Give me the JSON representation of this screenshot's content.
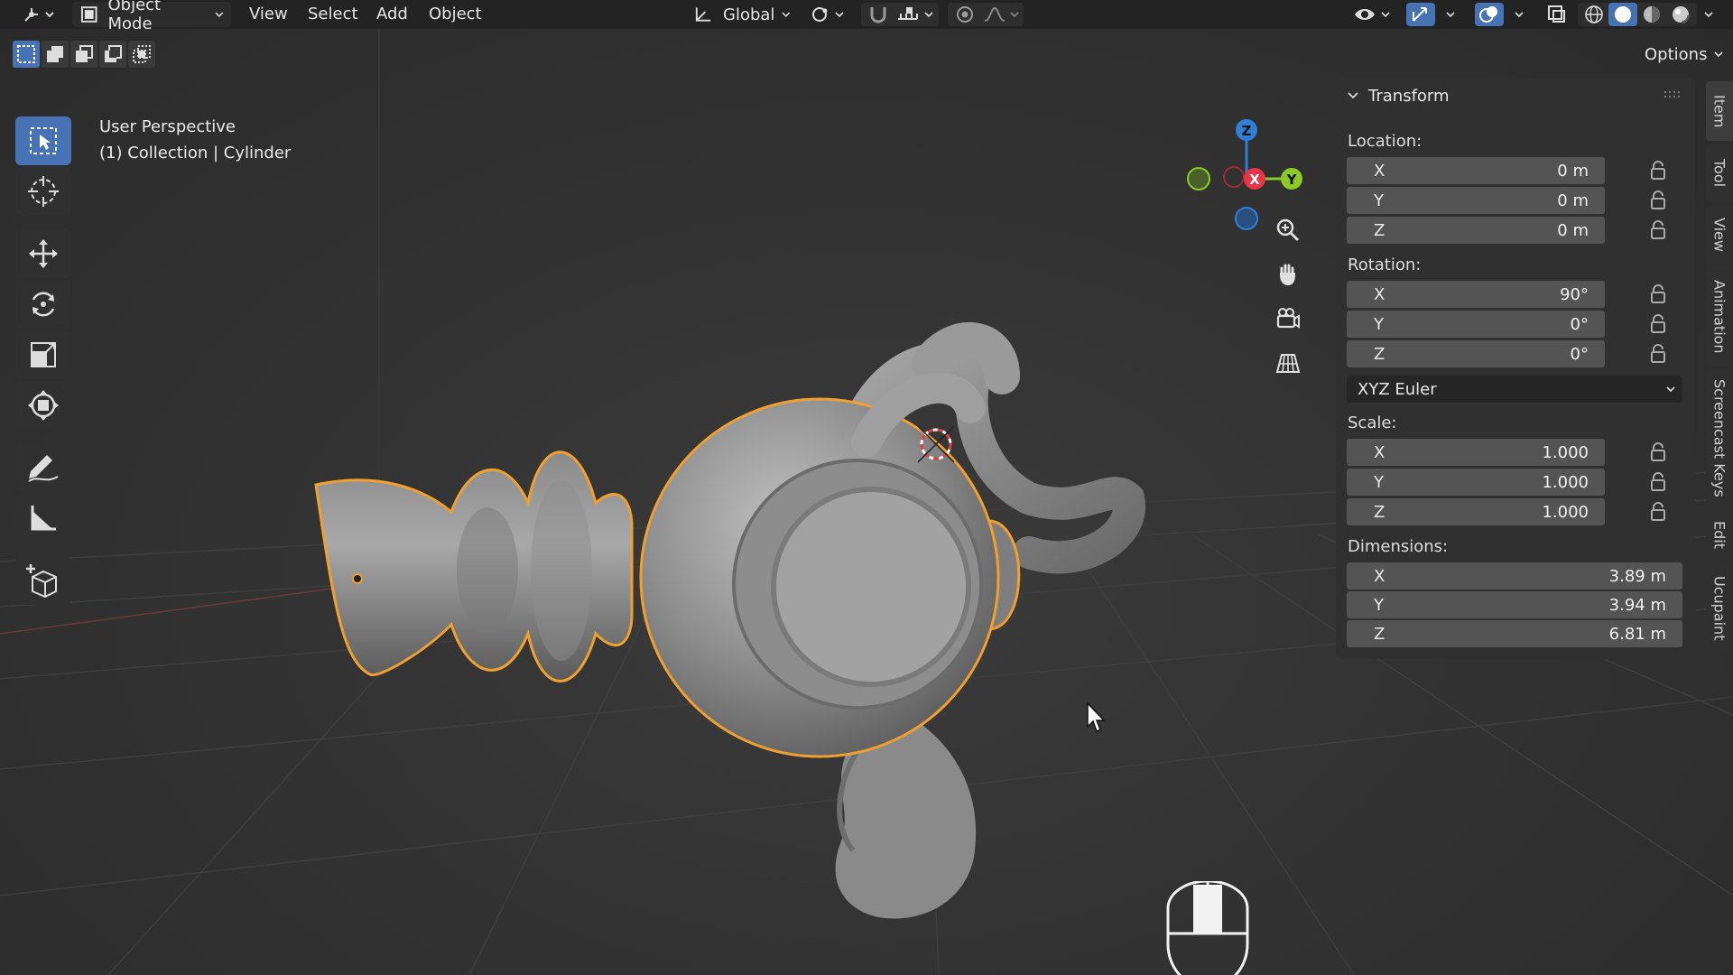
{
  "header": {
    "mode_label": "Object Mode",
    "menus": [
      "View",
      "Select",
      "Add",
      "Object"
    ],
    "orientation_label": "Global",
    "options_label": "Options"
  },
  "viewport": {
    "perspective_label": "User Perspective",
    "collection_label": "(1) Collection | Cylinder",
    "gizmo": {
      "x_label": "X",
      "y_label": "Y",
      "z_label": "Z"
    }
  },
  "toolbar": {
    "tools": [
      "select-box",
      "cursor",
      "move",
      "rotate",
      "scale",
      "transform",
      "annotate",
      "measure",
      "add-cube"
    ],
    "active_tool": "select-box"
  },
  "npanel": {
    "title": "Transform",
    "location": {
      "label": "Location:",
      "rows": [
        {
          "axis": "X",
          "value": "0 m"
        },
        {
          "axis": "Y",
          "value": "0 m"
        },
        {
          "axis": "Z",
          "value": "0 m"
        }
      ]
    },
    "rotation": {
      "label": "Rotation:",
      "rows": [
        {
          "axis": "X",
          "value": "90°"
        },
        {
          "axis": "Y",
          "value": "0°"
        },
        {
          "axis": "Z",
          "value": "0°"
        }
      ]
    },
    "rotation_mode": "XYZ Euler",
    "scale": {
      "label": "Scale:",
      "rows": [
        {
          "axis": "X",
          "value": "1.000"
        },
        {
          "axis": "Y",
          "value": "1.000"
        },
        {
          "axis": "Z",
          "value": "1.000"
        }
      ]
    },
    "dimensions": {
      "label": "Dimensions:",
      "rows": [
        {
          "axis": "X",
          "value": "3.89 m"
        },
        {
          "axis": "Y",
          "value": "3.94 m"
        },
        {
          "axis": "Z",
          "value": "6.81 m"
        }
      ]
    }
  },
  "sidetabs": [
    "Item",
    "Tool",
    "View",
    "Animation",
    "Screencast Keys",
    "Edit",
    "Ucupaint"
  ],
  "colors": {
    "accent": "#4772b3",
    "selection_outline": "#f0a030",
    "axis_x": "#e8344a",
    "axis_y": "#8ac926",
    "axis_z": "#2f7fd6"
  }
}
